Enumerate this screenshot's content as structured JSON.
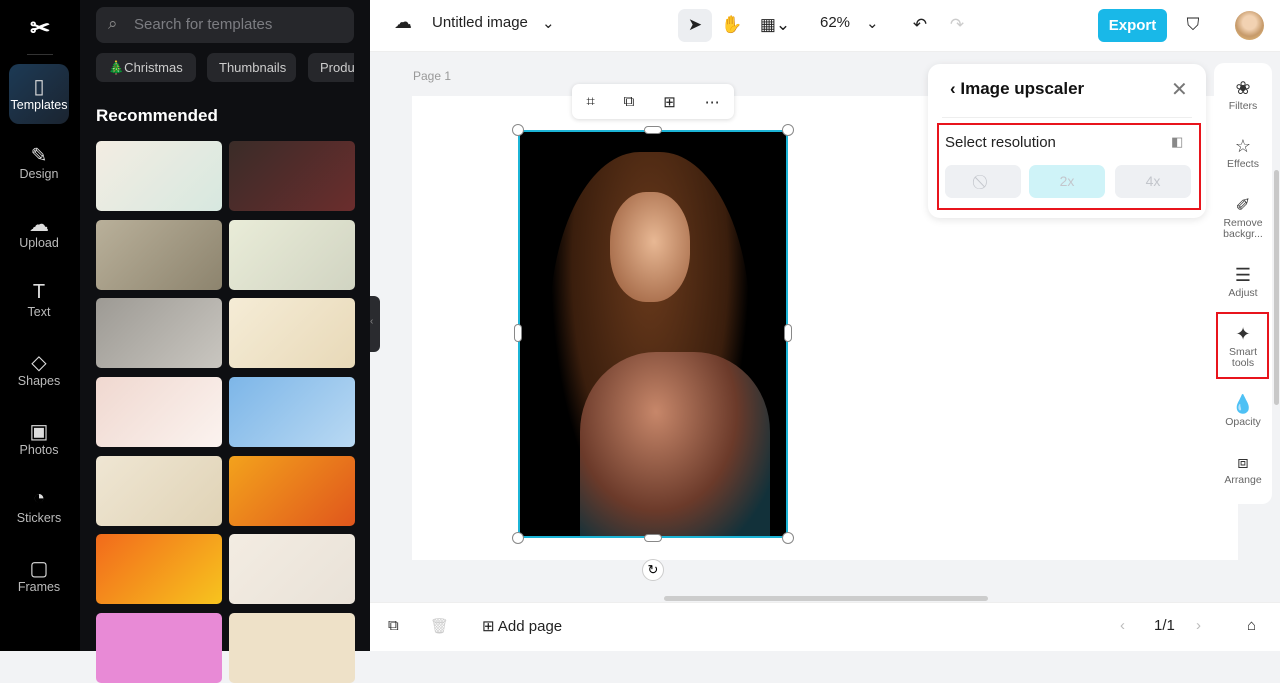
{
  "rail": {
    "items": [
      {
        "label": "Templates",
        "icon": "templates-icon",
        "glyph": "▯"
      },
      {
        "label": "Design",
        "icon": "design-icon",
        "glyph": "✎"
      },
      {
        "label": "Upload",
        "icon": "upload-icon",
        "glyph": "☁"
      },
      {
        "label": "Text",
        "icon": "text-icon",
        "glyph": "T"
      },
      {
        "label": "Shapes",
        "icon": "shapes-icon",
        "glyph": "◇"
      },
      {
        "label": "Photos",
        "icon": "photos-icon",
        "glyph": "▣"
      },
      {
        "label": "Stickers",
        "icon": "stickers-icon",
        "glyph": "◔"
      },
      {
        "label": "Frames",
        "icon": "frames-icon",
        "glyph": "▢"
      }
    ]
  },
  "panel": {
    "search_placeholder": "Search for templates",
    "chips": [
      "🎄Christmas",
      "Thumbnails",
      "Product"
    ],
    "section_title": "Recommended"
  },
  "topbar": {
    "title": "Untitled image",
    "zoom": "62%",
    "export": "Export"
  },
  "canvas": {
    "page_label": "Page 1"
  },
  "upscaler": {
    "title": "Image upscaler",
    "select_label": "Select resolution",
    "options": [
      "⃠",
      "2x",
      "4x"
    ],
    "selected": "2x"
  },
  "right_panel": {
    "items": [
      {
        "label": "Filters",
        "glyph": "❀"
      },
      {
        "label": "Effects",
        "glyph": "☆"
      },
      {
        "label": "Remove backgr...",
        "glyph": "✐"
      },
      {
        "label": "Adjust",
        "glyph": "☰"
      },
      {
        "label": "Smart tools",
        "glyph": "✦"
      },
      {
        "label": "Opacity",
        "glyph": "💧"
      },
      {
        "label": "Arrange",
        "glyph": "⧈"
      }
    ]
  },
  "bottom": {
    "add_page": "Add page",
    "pagination": "1/1"
  },
  "colors": {
    "accent": "#19b8e8",
    "highlight": "#e8141c"
  }
}
